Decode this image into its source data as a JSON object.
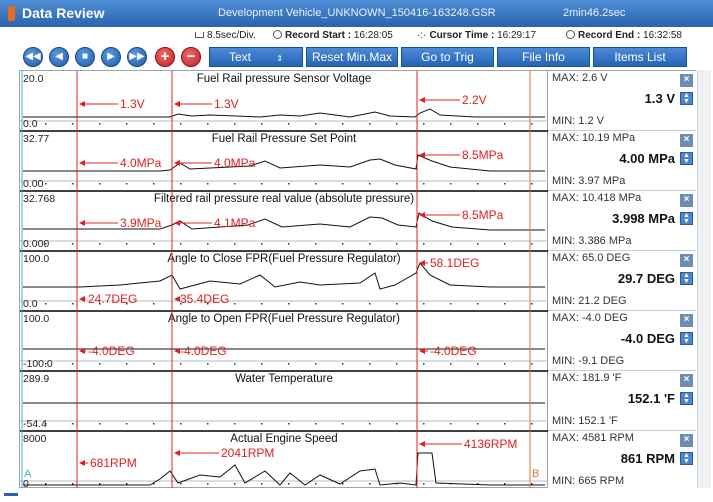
{
  "title": {
    "app": "Data Review",
    "file": "Development Vehicle_UNKNOWN_150416-163248.GSR",
    "duration": "2min46.2sec"
  },
  "info": {
    "div": "8.5sec/Div.",
    "record_start_label": "Record Start :",
    "record_start": "16:28:05",
    "cursor_time_label": "Cursor Time :",
    "cursor_time": "16:29:17",
    "record_end_label": "Record End :",
    "record_end": "16:32:58"
  },
  "toolbar": {
    "text": "Text",
    "reset": "Reset Min.Max",
    "trig": "Go to Trig",
    "file_info": "File Info",
    "items_list": "Items List"
  },
  "markers": {
    "a": "A",
    "b": "B"
  },
  "channels": [
    {
      "name": "Fuel Rail pressure Sensor Voltage",
      "ymax": "20.0",
      "ymin": "0.0",
      "max": "MAX:   2.6 V",
      "current": "1.3 V",
      "min": "MIN:   1.2 V",
      "labels": [
        "1.3V",
        "1.3V",
        "2.2V"
      ]
    },
    {
      "name": "Fuel Rail Pressure Set Point",
      "ymax": "32.77",
      "ymin": "0.00",
      "max": "MAX: 10.19 MPa",
      "current": "4.00 MPa",
      "min": "MIN:  3.97 MPa",
      "labels": [
        "4.0MPa",
        "4.0MPa",
        "8.5MPa"
      ]
    },
    {
      "name": "Filtered rail pressure real value (absolute pressure)",
      "ymax": "32.768",
      "ymin": "0.000",
      "max": "MAX: 10.418 MPa",
      "current": "3.998 MPa",
      "min": "MIN: 3.386 MPa",
      "labels": [
        "3.9MPa",
        "4.1MPa",
        "8.5MPa"
      ]
    },
    {
      "name": "Angle to Close FPR(Fuel Pressure Regulator)",
      "ymax": "100.0",
      "ymin": "0.0",
      "max": "MAX:  65.0 DEG",
      "current": "29.7 DEG",
      "min": "MIN:  21.2 DEG",
      "labels": [
        "24.7DEG",
        "35.4DEG",
        "58.1DEG"
      ]
    },
    {
      "name": "Angle to Open FPR(Fuel Pressure Regulator)",
      "ymax": "100.0",
      "ymin": "-100.0",
      "max": "MAX:   -4.0 DEG",
      "current": "-4.0 DEG",
      "min": "MIN:   -9.1 DEG",
      "labels": [
        "-4.0DEG",
        "-4.0DEG",
        "-4.0DEG"
      ]
    },
    {
      "name": "Water Temperature",
      "ymax": "289.9",
      "ymin": "-54.4",
      "max": "MAX: 181.9 'F",
      "current": "152.1 'F",
      "min": "MIN: 152.1 'F",
      "labels": []
    },
    {
      "name": "Actual Engine Speed",
      "ymax": "8000",
      "ymin": "0",
      "max": "MAX:   4581 RPM",
      "current": "861 RPM",
      "min": "MIN:    665 RPM",
      "labels": [
        "681RPM",
        "2041RPM",
        "4136RPM"
      ]
    }
  ],
  "colors": {
    "titlebar": "#2a63b0",
    "trace": "#111111",
    "cursor": "#e02020",
    "marker_a": "#46b3c8",
    "marker_b": "#e0733a",
    "annotation": "#e02020"
  }
}
